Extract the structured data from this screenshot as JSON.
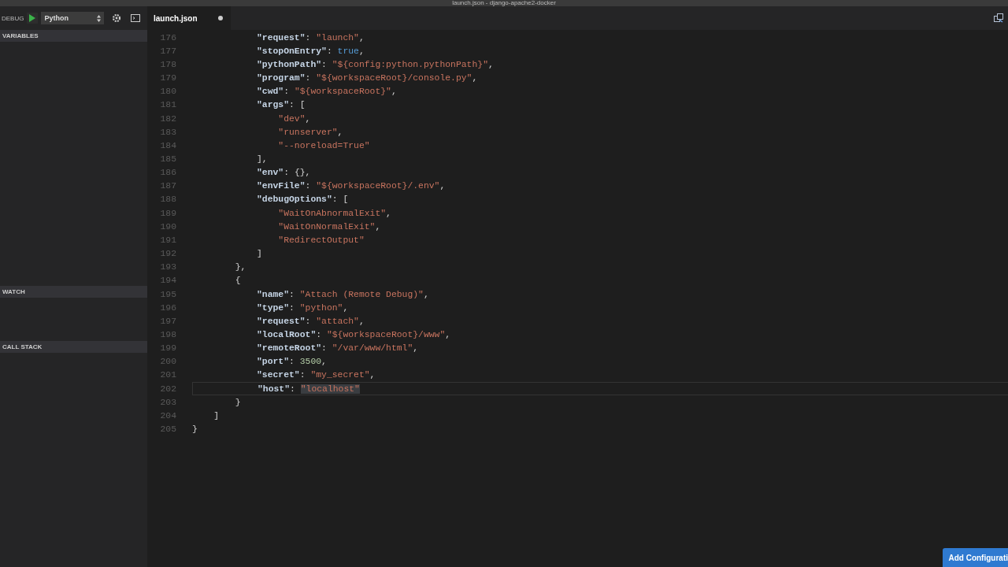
{
  "window": {
    "title": "launch.json - django-apache2-docker"
  },
  "debug_toolbar": {
    "label": "DEBUG",
    "configuration": "Python"
  },
  "sidebar": {
    "sections": [
      {
        "title": "VARIABLES"
      },
      {
        "title": "WATCH"
      },
      {
        "title": "CALL STACK"
      }
    ]
  },
  "tabs": [
    {
      "label": "launch.json",
      "selected": true,
      "dirty": true
    }
  ],
  "editor": {
    "lines": [
      {
        "number": "176",
        "current": false,
        "tokens": [
          {
            "kind": "key",
            "text": "            \"request\""
          },
          {
            "kind": "punct",
            "text": ": "
          },
          {
            "kind": "string",
            "text": "\"launch\""
          },
          {
            "kind": "punct",
            "text": ","
          }
        ]
      },
      {
        "number": "177",
        "current": false,
        "tokens": [
          {
            "kind": "key",
            "text": "            \"stopOnEntry\""
          },
          {
            "kind": "punct",
            "text": ": "
          },
          {
            "kind": "bool",
            "text": "true"
          },
          {
            "kind": "punct",
            "text": ","
          }
        ]
      },
      {
        "number": "178",
        "current": false,
        "tokens": [
          {
            "kind": "key",
            "text": "            \"pythonPath\""
          },
          {
            "kind": "punct",
            "text": ": "
          },
          {
            "kind": "string",
            "text": "\"${config:python.pythonPath}\""
          },
          {
            "kind": "punct",
            "text": ","
          }
        ]
      },
      {
        "number": "179",
        "current": false,
        "tokens": [
          {
            "kind": "key",
            "text": "            \"program\""
          },
          {
            "kind": "punct",
            "text": ": "
          },
          {
            "kind": "string",
            "text": "\"${workspaceRoot}/console.py\""
          },
          {
            "kind": "punct",
            "text": ","
          }
        ]
      },
      {
        "number": "180",
        "current": false,
        "tokens": [
          {
            "kind": "key",
            "text": "            \"cwd\""
          },
          {
            "kind": "punct",
            "text": ": "
          },
          {
            "kind": "string",
            "text": "\"${workspaceRoot}\""
          },
          {
            "kind": "punct",
            "text": ","
          }
        ]
      },
      {
        "number": "181",
        "current": false,
        "tokens": [
          {
            "kind": "key",
            "text": "            \"args\""
          },
          {
            "kind": "punct",
            "text": ": ["
          }
        ]
      },
      {
        "number": "182",
        "current": false,
        "tokens": [
          {
            "kind": "string",
            "text": "                \"dev\""
          },
          {
            "kind": "punct",
            "text": ","
          }
        ]
      },
      {
        "number": "183",
        "current": false,
        "tokens": [
          {
            "kind": "string",
            "text": "                \"runserver\""
          },
          {
            "kind": "punct",
            "text": ","
          }
        ]
      },
      {
        "number": "184",
        "current": false,
        "tokens": [
          {
            "kind": "string",
            "text": "                \"--noreload=True\""
          }
        ]
      },
      {
        "number": "185",
        "current": false,
        "tokens": [
          {
            "kind": "punct",
            "text": "            ],"
          }
        ]
      },
      {
        "number": "186",
        "current": false,
        "tokens": [
          {
            "kind": "key",
            "text": "            \"env\""
          },
          {
            "kind": "punct",
            "text": ": {},"
          }
        ]
      },
      {
        "number": "187",
        "current": false,
        "tokens": [
          {
            "kind": "key",
            "text": "            \"envFile\""
          },
          {
            "kind": "punct",
            "text": ": "
          },
          {
            "kind": "string",
            "text": "\"${workspaceRoot}/.env\""
          },
          {
            "kind": "punct",
            "text": ","
          }
        ]
      },
      {
        "number": "188",
        "current": false,
        "tokens": [
          {
            "kind": "key",
            "text": "            \"debugOptions\""
          },
          {
            "kind": "punct",
            "text": ": ["
          }
        ]
      },
      {
        "number": "189",
        "current": false,
        "tokens": [
          {
            "kind": "string",
            "text": "                \"WaitOnAbnormalExit\""
          },
          {
            "kind": "punct",
            "text": ","
          }
        ]
      },
      {
        "number": "190",
        "current": false,
        "tokens": [
          {
            "kind": "string",
            "text": "                \"WaitOnNormalExit\""
          },
          {
            "kind": "punct",
            "text": ","
          }
        ]
      },
      {
        "number": "191",
        "current": false,
        "tokens": [
          {
            "kind": "string",
            "text": "                \"RedirectOutput\""
          }
        ]
      },
      {
        "number": "192",
        "current": false,
        "tokens": [
          {
            "kind": "punct",
            "text": "            ]"
          }
        ]
      },
      {
        "number": "193",
        "current": false,
        "tokens": [
          {
            "kind": "punct",
            "text": "        },"
          }
        ]
      },
      {
        "number": "194",
        "current": false,
        "tokens": [
          {
            "kind": "punct",
            "text": "        {"
          }
        ]
      },
      {
        "number": "195",
        "current": false,
        "tokens": [
          {
            "kind": "key",
            "text": "            \"name\""
          },
          {
            "kind": "punct",
            "text": ": "
          },
          {
            "kind": "string",
            "text": "\"Attach (Remote Debug)\""
          },
          {
            "kind": "punct",
            "text": ","
          }
        ]
      },
      {
        "number": "196",
        "current": false,
        "tokens": [
          {
            "kind": "key",
            "text": "            \"type\""
          },
          {
            "kind": "punct",
            "text": ": "
          },
          {
            "kind": "string",
            "text": "\"python\""
          },
          {
            "kind": "punct",
            "text": ","
          }
        ]
      },
      {
        "number": "197",
        "current": false,
        "tokens": [
          {
            "kind": "key",
            "text": "            \"request\""
          },
          {
            "kind": "punct",
            "text": ": "
          },
          {
            "kind": "string",
            "text": "\"attach\""
          },
          {
            "kind": "punct",
            "text": ","
          }
        ]
      },
      {
        "number": "198",
        "current": false,
        "tokens": [
          {
            "kind": "key",
            "text": "            \"localRoot\""
          },
          {
            "kind": "punct",
            "text": ": "
          },
          {
            "kind": "string",
            "text": "\"${workspaceRoot}/www\""
          },
          {
            "kind": "punct",
            "text": ","
          }
        ]
      },
      {
        "number": "199",
        "current": false,
        "tokens": [
          {
            "kind": "key",
            "text": "            \"remoteRoot\""
          },
          {
            "kind": "punct",
            "text": ": "
          },
          {
            "kind": "string",
            "text": "\"/var/www/html\""
          },
          {
            "kind": "punct",
            "text": ","
          }
        ]
      },
      {
        "number": "200",
        "current": false,
        "tokens": [
          {
            "kind": "key",
            "text": "            \"port\""
          },
          {
            "kind": "punct",
            "text": ": "
          },
          {
            "kind": "number",
            "text": "3500"
          },
          {
            "kind": "punct",
            "text": ","
          }
        ]
      },
      {
        "number": "201",
        "current": false,
        "tokens": [
          {
            "kind": "key",
            "text": "            \"secret\""
          },
          {
            "kind": "punct",
            "text": ": "
          },
          {
            "kind": "string",
            "text": "\"my_secret\""
          },
          {
            "kind": "punct",
            "text": ","
          }
        ]
      },
      {
        "number": "202",
        "current": true,
        "tokens": [
          {
            "kind": "key",
            "text": "            \"host\""
          },
          {
            "kind": "punct",
            "text": ": "
          },
          {
            "kind": "selection",
            "text": "\"localhost\""
          }
        ]
      },
      {
        "number": "203",
        "current": false,
        "tokens": [
          {
            "kind": "punct",
            "text": "        }"
          }
        ]
      },
      {
        "number": "204",
        "current": false,
        "tokens": [
          {
            "kind": "punct",
            "text": "    ]"
          }
        ]
      },
      {
        "number": "205",
        "current": false,
        "tokens": [
          {
            "kind": "punct",
            "text": "}"
          }
        ]
      }
    ]
  },
  "add_button": {
    "label": "Add Configurati"
  }
}
